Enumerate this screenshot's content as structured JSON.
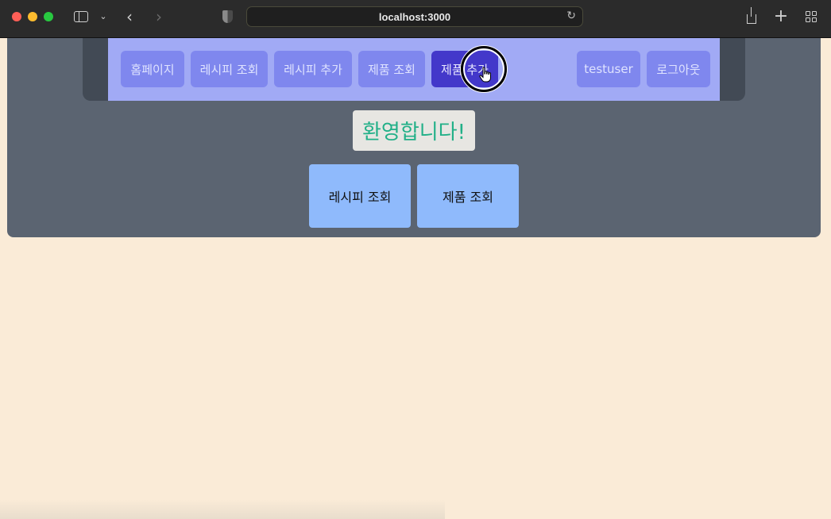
{
  "browser": {
    "url": "localhost:3000",
    "icons": {
      "back": "‹",
      "forward": "›",
      "chevron": "⌄",
      "reload": "↻",
      "new_tab": "+"
    }
  },
  "nav": {
    "items": [
      {
        "label": "홈페이지"
      },
      {
        "label": "레시피 조회"
      },
      {
        "label": "레시피 추가"
      },
      {
        "label": "제품 조회"
      },
      {
        "label": "제품 추가"
      }
    ],
    "user": "testuser",
    "logout": "로그아웃"
  },
  "main": {
    "welcome": "환영합니다!",
    "buttons": [
      {
        "label": "레시피 조회"
      },
      {
        "label": "제품 조회"
      }
    ]
  },
  "colors": {
    "page_bg": "#faebd7",
    "panel": "#5b6471",
    "navbar": "#a1aaf5",
    "nav_button": "#7f87ee",
    "nav_active": "#4338ca",
    "welcome_text": "#22b088",
    "big_button": "#8fbafc"
  }
}
